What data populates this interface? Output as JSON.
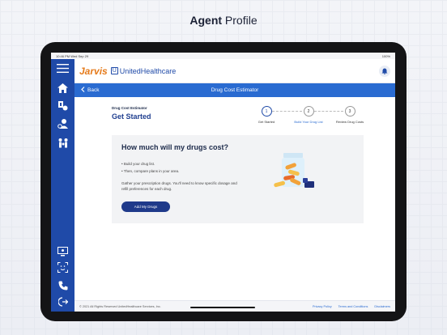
{
  "headline": {
    "bold": "Agent",
    "rest": " Profile"
  },
  "status": {
    "time": "10:46 PM",
    "date": "Wed Sep 29",
    "battery": "100%"
  },
  "brand": {
    "name": "Jarvis",
    "partner": "UnitedHealthcare"
  },
  "nav": {
    "back_label": "Back",
    "title": "Drug Cost Estimator"
  },
  "page": {
    "sub_label": "Drug Cost Estimator",
    "title": "Get Started"
  },
  "steps": [
    {
      "num": "1",
      "label": "Get Started"
    },
    {
      "num": "2",
      "label": "Build Your Drug List"
    },
    {
      "num": "3",
      "label": "Review Drug Costs"
    }
  ],
  "card": {
    "title": "How much will my drugs cost?",
    "bullets": [
      "• Build your drug list.",
      "• Then, compare plans in your area."
    ],
    "description": "Gather your prescription drugs. You'll need to know specific dosage and refill preferences for each drug.",
    "button_label": "Add My Drugs"
  },
  "footer": {
    "copyright": "© 2021 All Rights Reserved UnitedHealthcare Services, Inc.",
    "links": [
      "Privacy Policy",
      "Terms and Conditions",
      "Disclaimers"
    ]
  },
  "icons": {
    "sidebar": [
      "menu-icon",
      "home-icon",
      "pharmacy-icon",
      "agent-icon",
      "family-icon",
      "monitor-icon",
      "face-id-icon",
      "phone-icon",
      "logout-icon"
    ],
    "bell": "bell-icon"
  },
  "colors": {
    "sidebar": "#1f4aa8",
    "navbar": "#2a6bd1",
    "brand_orange": "#e57a1a",
    "button": "#1f3a8a"
  }
}
